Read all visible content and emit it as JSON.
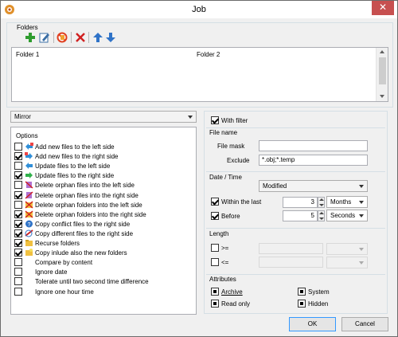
{
  "window": {
    "title": "Job",
    "close_glyph": "✕"
  },
  "folders": {
    "group_label": "Folders",
    "toolbar": [
      "add-folder-icon",
      "edit-folder-icon",
      "disable-icon",
      "delete-icon",
      "move-up-icon",
      "move-down-icon"
    ],
    "columns": [
      "Folder 1",
      "Folder 2"
    ]
  },
  "mode": {
    "selected": "Mirror"
  },
  "options": {
    "label": "Options",
    "items": [
      {
        "label": "Add new files to the left side",
        "checked": false,
        "icon": "add-left-icon"
      },
      {
        "label": "Add new files to the right side",
        "checked": true,
        "icon": "add-right-icon"
      },
      {
        "label": "Update files to the left side",
        "checked": false,
        "icon": "update-left-icon"
      },
      {
        "label": "Update files to the right side",
        "checked": true,
        "icon": "update-right-icon"
      },
      {
        "label": "Delete orphan files into the left side",
        "checked": false,
        "icon": "delete-files-left-icon"
      },
      {
        "label": "Delete orphan files into the right side",
        "checked": true,
        "icon": "delete-files-right-icon"
      },
      {
        "label": "Delete orphan folders into the left side",
        "checked": false,
        "icon": "delete-folders-left-icon"
      },
      {
        "label": "Delete orphan folders into the right side",
        "checked": true,
        "icon": "delete-folders-right-icon"
      },
      {
        "label": "Copy conflict files to the right side",
        "checked": true,
        "icon": "conflict-icon"
      },
      {
        "label": "Copy different files to the right side",
        "checked": true,
        "icon": "different-icon"
      },
      {
        "label": "Recurse folders",
        "checked": true,
        "icon": "recurse-folder-icon"
      },
      {
        "label": "Copy inlude also the new folders",
        "checked": true,
        "icon": "new-folder-icon"
      },
      {
        "label": "Compare by content",
        "checked": false,
        "icon": ""
      },
      {
        "label": "Ignore date",
        "checked": false,
        "icon": ""
      },
      {
        "label": "Tolerate until two second time difference",
        "checked": false,
        "icon": ""
      },
      {
        "label": "Ignore one hour time",
        "checked": false,
        "icon": ""
      }
    ]
  },
  "filter": {
    "with_filter_label": "With filter",
    "with_filter_checked": true,
    "file_name": {
      "label": "File name",
      "mask_label": "File mask",
      "mask_value": "",
      "exclude_label": "Exclude",
      "exclude_value": "*.obj;*.temp"
    },
    "date_time": {
      "label": "Date / Time",
      "mode": "Modified",
      "within_label": "Within the last",
      "within_checked": true,
      "within_value": "3",
      "within_unit": "Months",
      "before_label": "Before",
      "before_checked": true,
      "before_value": "5",
      "before_unit": "Seconds"
    },
    "length": {
      "label": "Length",
      "ge_label": ">=",
      "ge_checked": false,
      "le_label": "<=",
      "le_checked": false
    },
    "attributes": {
      "label": "Attributes",
      "archive": "Archive",
      "system": "System",
      "read_only": "Read only",
      "hidden": "Hidden"
    }
  },
  "buttons": {
    "ok": "OK",
    "cancel": "Cancel"
  }
}
